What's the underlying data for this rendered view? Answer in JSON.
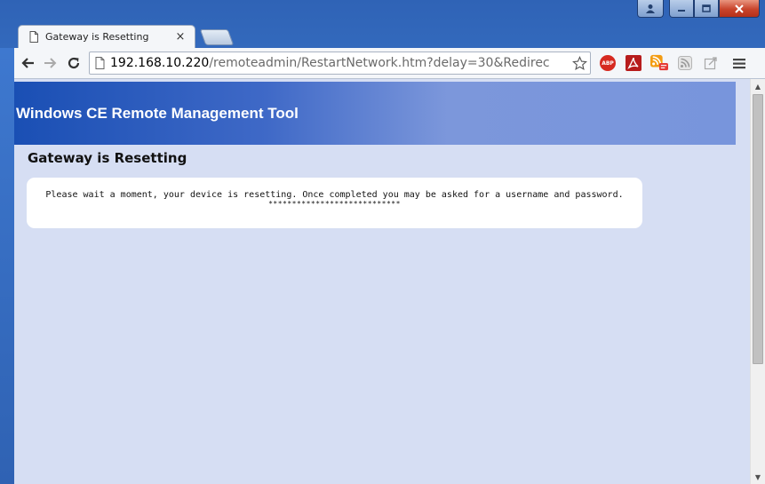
{
  "window": {
    "caption_buttons": {
      "user_icon": "user-icon",
      "minimize": "–",
      "maximize": "□",
      "close": "✕"
    }
  },
  "tab": {
    "title": "Gateway is Resetting",
    "close": "×",
    "icon": "page-icon"
  },
  "toolbar": {
    "back_icon": "back-arrow-icon",
    "forward_icon": "forward-arrow-icon",
    "reload_icon": "reload-icon",
    "url_host": "192.168.10.220",
    "url_path": "/remoteadmin/RestartNetwork.htm?delay=30&Redirec",
    "bookmark_icon": "star-icon",
    "extensions": [
      {
        "name": "adblock-plus-icon",
        "label": "ABP"
      },
      {
        "name": "acrobat-icon"
      },
      {
        "name": "rss-subscription-icon"
      },
      {
        "name": "rss-feed-icon"
      },
      {
        "name": "share-icon"
      }
    ],
    "menu_icon": "hamburger-menu-icon"
  },
  "page": {
    "banner_title": "Windows CE Remote Management Tool",
    "heading": "Gateway is Resetting",
    "message": "Please wait a moment, your device is resetting. Once completed you may be asked for a username and password.",
    "stars": "****************************"
  },
  "colors": {
    "banner_start": "#1a4fb4",
    "banner_end": "#7895dc",
    "page_background": "#d6def3",
    "message_box": "#ffffff"
  }
}
